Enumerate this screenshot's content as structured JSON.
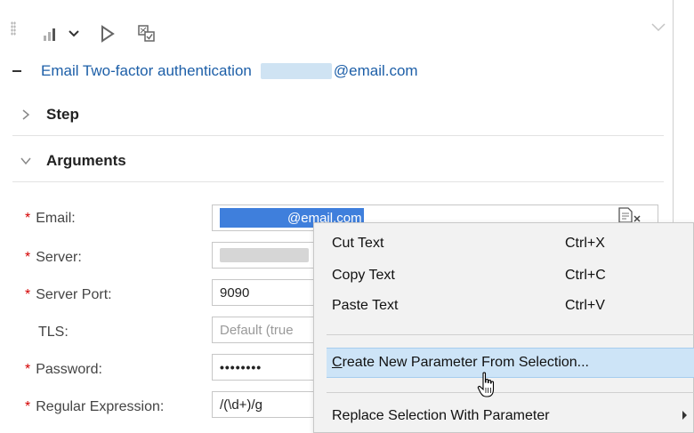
{
  "toolbar": {
    "icons": [
      "chart-bars-icon",
      "chevron-down-icon",
      "play-icon",
      "checkbox-grid-icon"
    ]
  },
  "title": {
    "prefix": "Email Two-factor authentication",
    "email_suffix": "@email.com"
  },
  "sections": {
    "step": "Step",
    "arguments": "Arguments"
  },
  "fields": {
    "email": {
      "label": "Email:",
      "required": true,
      "value_suffix": "@email.com"
    },
    "server": {
      "label": "Server:",
      "required": true,
      "value": ""
    },
    "server_port": {
      "label": "Server Port:",
      "required": true,
      "value": "9090"
    },
    "tls": {
      "label": "TLS:",
      "required": false,
      "placeholder": "Default (true"
    },
    "password": {
      "label": "Password:",
      "required": true,
      "value": "••••••••"
    },
    "regex": {
      "label": "Regular Expression:",
      "required": true,
      "value": "/(\\d+)/g"
    }
  },
  "required_marker": "*",
  "context_menu": {
    "cut": {
      "label": "Cut Text",
      "shortcut": "Ctrl+X"
    },
    "copy": {
      "label": "Copy Text",
      "shortcut": "Ctrl+C"
    },
    "paste": {
      "label": "Paste Text",
      "shortcut": "Ctrl+V"
    },
    "create_param": {
      "label_first": "C",
      "label_rest": "reate New Parameter From Selection..."
    },
    "replace_param": {
      "label": "Replace Selection With Parameter"
    }
  },
  "colors": {
    "link_blue": "#1d5fa8",
    "selection_blue": "#3f7fdc",
    "required_red": "#d40000",
    "menu_hover": "#cde4f7"
  }
}
